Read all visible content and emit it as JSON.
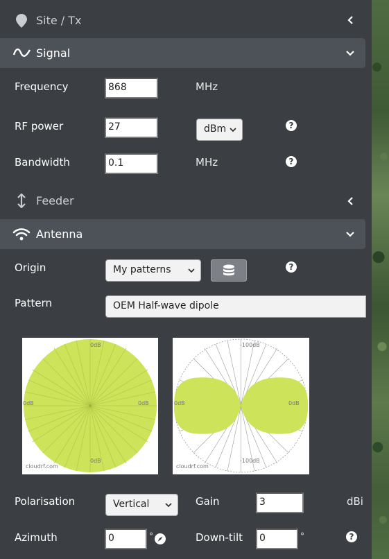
{
  "sections": {
    "site": {
      "title": "Site / Tx",
      "icon": "map-pin-icon"
    },
    "signal": {
      "title": "Signal",
      "icon": "sine-wave-icon"
    },
    "feeder": {
      "title": "Feeder",
      "icon": "vertical-arrows-icon"
    },
    "antenna": {
      "title": "Antenna",
      "icon": "wifi-icon"
    }
  },
  "signal": {
    "frequency": {
      "label": "Frequency",
      "value": "868",
      "unit": "MHz"
    },
    "rf_power": {
      "label": "RF power",
      "value": "27",
      "unit_select": "dBm"
    },
    "bandwidth": {
      "label": "Bandwidth",
      "value": "0.1",
      "unit": "MHz"
    }
  },
  "antenna": {
    "origin": {
      "label": "Origin",
      "selected": "My patterns"
    },
    "pattern": {
      "label": "Pattern",
      "value": "OEM Half-wave dipole"
    },
    "plots": {
      "horizontal": {
        "top": "0dB",
        "left": "0dB",
        "right": "0dB",
        "bottom": "0dB",
        "watermark": "cloudrf.com"
      },
      "vertical": {
        "top": "-100dB",
        "left": "0dB",
        "right": "0dB",
        "bottom": "-100dB",
        "watermark": "cloudrf.com"
      }
    },
    "polarisation": {
      "label": "Polarisation",
      "selected": "Vertical"
    },
    "gain": {
      "label": "Gain",
      "value": "3",
      "unit": "dBi"
    },
    "azimuth": {
      "label": "Azimuth",
      "value": "0",
      "unit": "°"
    },
    "downtilt": {
      "label": "Down-tilt",
      "value": "0",
      "unit": "°"
    }
  },
  "help_glyph": "?",
  "colors": {
    "panel_bg": "#3b3f44",
    "header_bar": "#4d5258",
    "pattern_fill": "#cde35a"
  }
}
